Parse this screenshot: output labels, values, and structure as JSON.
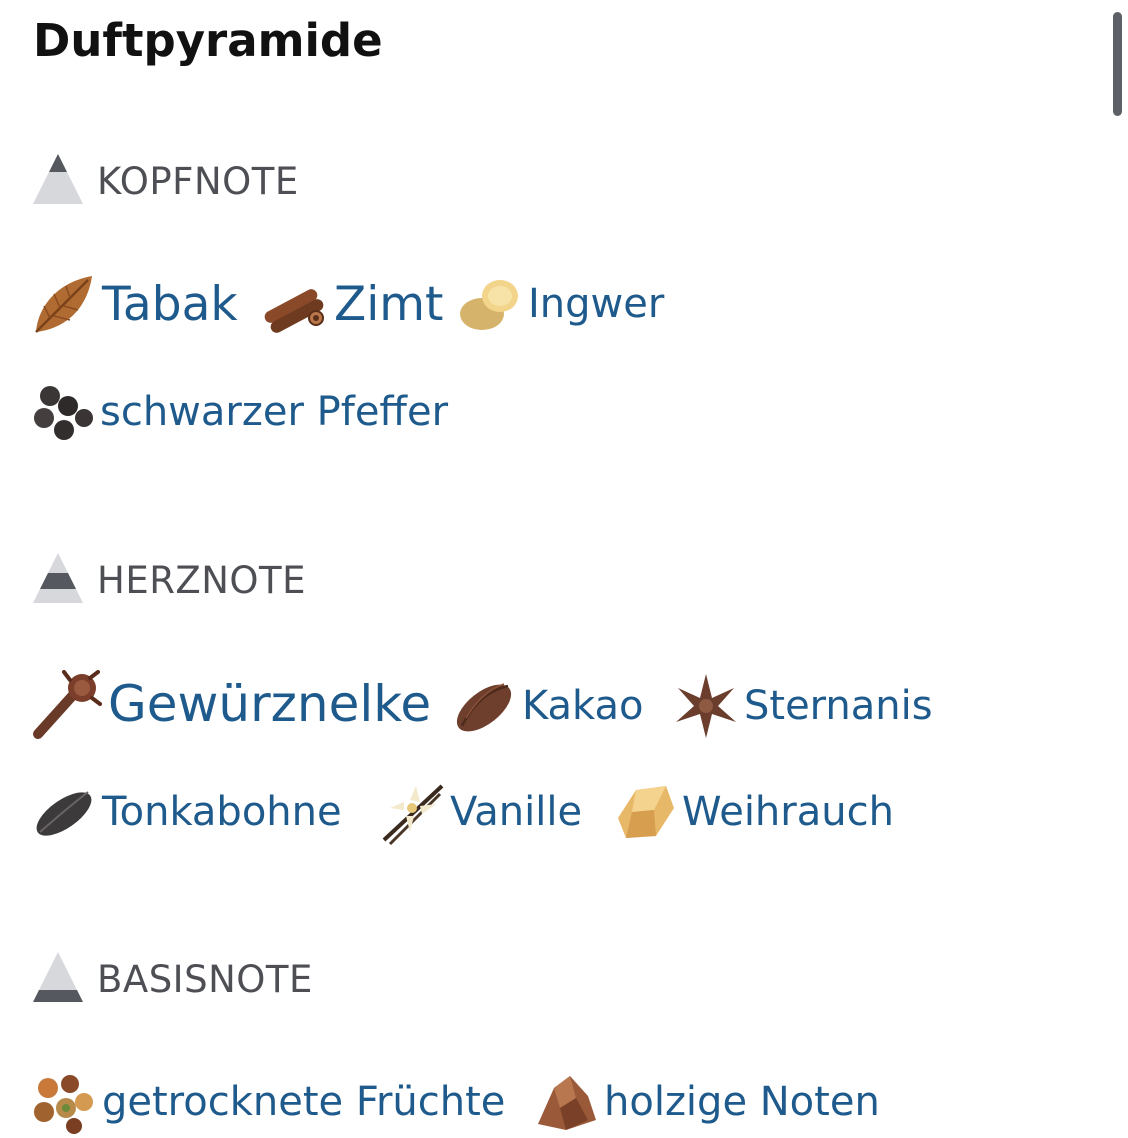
{
  "page": {
    "title": "Duftpyramide"
  },
  "colors": {
    "link": "#1e5a8c",
    "heading": "#111111",
    "section": "#4d4f55"
  },
  "sections": [
    {
      "label": "KOPFNOTE",
      "level_icon": "pyramid-top-icon",
      "notes": [
        {
          "label": "Tabak",
          "icon": "tobacco-leaf-icon"
        },
        {
          "label": "Zimt",
          "icon": "cinnamon-icon"
        },
        {
          "label": "Ingwer",
          "icon": "ginger-icon"
        },
        {
          "label": "schwarzer Pfeffer",
          "icon": "black-pepper-icon"
        }
      ]
    },
    {
      "label": "HERZNOTE",
      "level_icon": "pyramid-middle-icon",
      "notes": [
        {
          "label": "Gewürznelke",
          "icon": "clove-icon"
        },
        {
          "label": "Kakao",
          "icon": "cocoa-pod-icon"
        },
        {
          "label": "Sternanis",
          "icon": "star-anise-icon"
        },
        {
          "label": "Tonkabohne",
          "icon": "tonka-bean-icon"
        },
        {
          "label": "Vanille",
          "icon": "vanilla-flower-icon"
        },
        {
          "label": "Weihrauch",
          "icon": "frankincense-icon"
        }
      ]
    },
    {
      "label": "BASISNOTE",
      "level_icon": "pyramid-base-icon",
      "notes": [
        {
          "label": "getrocknete Früchte",
          "icon": "dried-fruits-icon"
        },
        {
          "label": "holzige Noten",
          "icon": "woody-notes-icon"
        }
      ]
    }
  ]
}
